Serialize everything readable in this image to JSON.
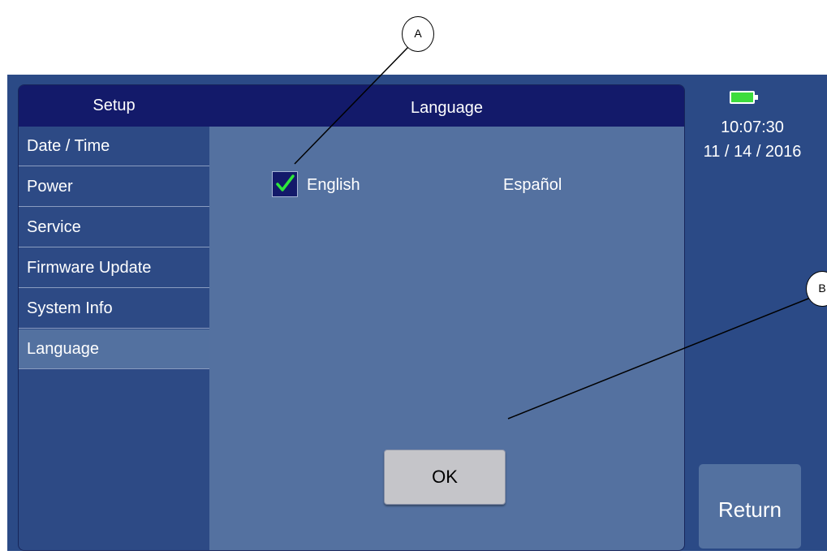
{
  "sidebar": {
    "header": "Setup",
    "items": [
      {
        "label": "Date / Time"
      },
      {
        "label": "Power"
      },
      {
        "label": "Service"
      },
      {
        "label": "Firmware Update"
      },
      {
        "label": "System Info"
      },
      {
        "label": "Language",
        "active": true
      }
    ]
  },
  "page": {
    "title": "Language"
  },
  "languages": {
    "english": {
      "label": "English",
      "checked": true
    },
    "spanish": {
      "label": "Español",
      "checked": false
    }
  },
  "ok_button": {
    "label": "OK"
  },
  "status": {
    "time": "10:07:30",
    "date": "11 / 14 / 2016",
    "battery_icon": "battery-full-icon",
    "battery_color": "#3ddc3d"
  },
  "return_button": {
    "label": "Return"
  },
  "callouts": {
    "a": {
      "label": "A"
    },
    "b": {
      "label": "B"
    }
  },
  "colors": {
    "title_bar": "#131a6a",
    "panel": "#5471a0",
    "sidebar": "#2d4a85",
    "check": "#2ee83a"
  }
}
